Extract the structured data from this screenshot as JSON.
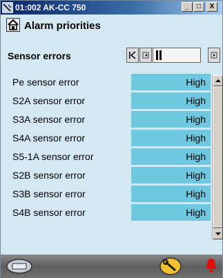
{
  "window": {
    "title": "01:002 AK-CC 750",
    "buttons": {
      "minimize": "_",
      "maximize": "□",
      "close": "X"
    }
  },
  "header": {
    "page_title": "Alarm priorities",
    "subtitle": "Sensor errors"
  },
  "rows": [
    {
      "label": "Pe sensor error",
      "value": "High"
    },
    {
      "label": "S2A sensor error",
      "value": "High"
    },
    {
      "label": "S3A sensor error",
      "value": "High"
    },
    {
      "label": "S4A sensor error",
      "value": "High"
    },
    {
      "label": "S5-1A sensor error",
      "value": "High"
    },
    {
      "label": "S2B sensor error",
      "value": "High"
    },
    {
      "label": "S3B sensor error",
      "value": "High"
    },
    {
      "label": "S4B sensor error",
      "value": "High"
    }
  ],
  "icons": {
    "window": "probe-icon",
    "home": "home-icon",
    "nav_first": "first-page-icon",
    "nav_prev": "previous-page-icon",
    "nav_position": "page-position-icon",
    "nav_next": "next-page-icon",
    "footer_left": "device-icon",
    "footer_service": "wrench-icon",
    "footer_alarm": "alarm-bell-icon"
  },
  "colors": {
    "background": "#d4e8f4",
    "value_cell": "#70c8e0",
    "footer": "#6a6a6a",
    "alarm": "#e01010",
    "service_button": "#f0c030"
  }
}
